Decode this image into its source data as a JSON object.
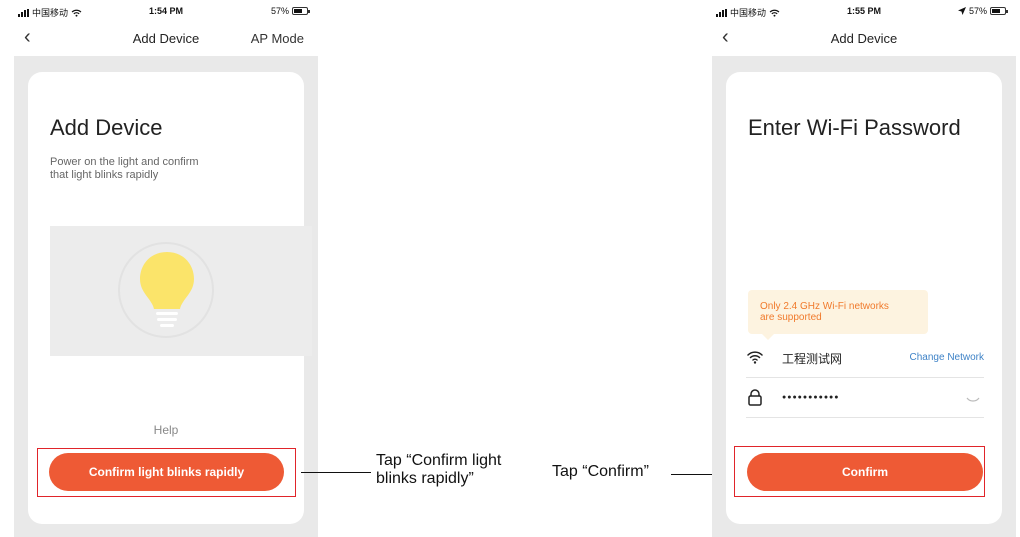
{
  "left": {
    "status": {
      "carrier": "中国移动",
      "time": "1:54 PM",
      "battery": "57%"
    },
    "nav": {
      "title": "Add Device",
      "right": "AP Mode"
    },
    "title": "Add Device",
    "description_lines": [
      "Power on the light and confirm",
      "that light blinks  rapidly"
    ],
    "help": "Help",
    "button": "Confirm light blinks rapidly"
  },
  "right": {
    "status": {
      "carrier": "中国移动",
      "time": "1:55 PM",
      "battery": "57%"
    },
    "nav": {
      "title": "Add Device"
    },
    "title": "Enter Wi-Fi Password",
    "tooltip_lines": [
      "Only 2.4 GHz Wi-Fi networks",
      "are supported"
    ],
    "wifi_name": "工程测试网",
    "change_network": "Change Network",
    "password_mask": "●●●●●●●●●●●",
    "button": "Confirm"
  },
  "annotations": {
    "left_lines": [
      "Tap “Confirm light",
      "blinks rapidly”"
    ],
    "right": "Tap “Confirm”"
  },
  "colors": {
    "accent": "#ee5a35",
    "highlight": "#e0242a",
    "link": "#3f83c7",
    "tooltip_bg": "#fdf3e0",
    "tooltip_text": "#f07a2c"
  }
}
